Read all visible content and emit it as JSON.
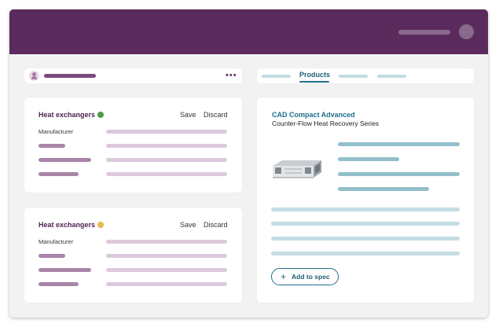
{
  "colors": {
    "brand": "#5b2b5e",
    "accent": "#1f6f8b",
    "status_green": "#4a9e47",
    "status_yellow": "#e6b94a"
  },
  "header": {
    "avatar_icon": "user-avatar-icon"
  },
  "breadcrumb": {
    "user_icon": "user-icon",
    "more_icon": "more-horizontal-icon",
    "more_label": "•••"
  },
  "tabs": {
    "active_label": "Products"
  },
  "cards": [
    {
      "title": "Heat exchangers",
      "status": "green",
      "save_label": "Save",
      "discard_label": "Discard",
      "field_label": "Manufacturer"
    },
    {
      "title": "Heat exchangers",
      "status": "yellow",
      "save_label": "Save",
      "discard_label": "Discard",
      "field_label": "Manufacturer"
    }
  ],
  "product": {
    "name": "CAD Compact Advanced",
    "subtitle": "Counter-Flow Heat Recovery Series",
    "image_icon": "heat-recovery-unit-image",
    "add_label": "Add to spec",
    "add_icon": "plus-icon",
    "add_glyph": "+"
  }
}
